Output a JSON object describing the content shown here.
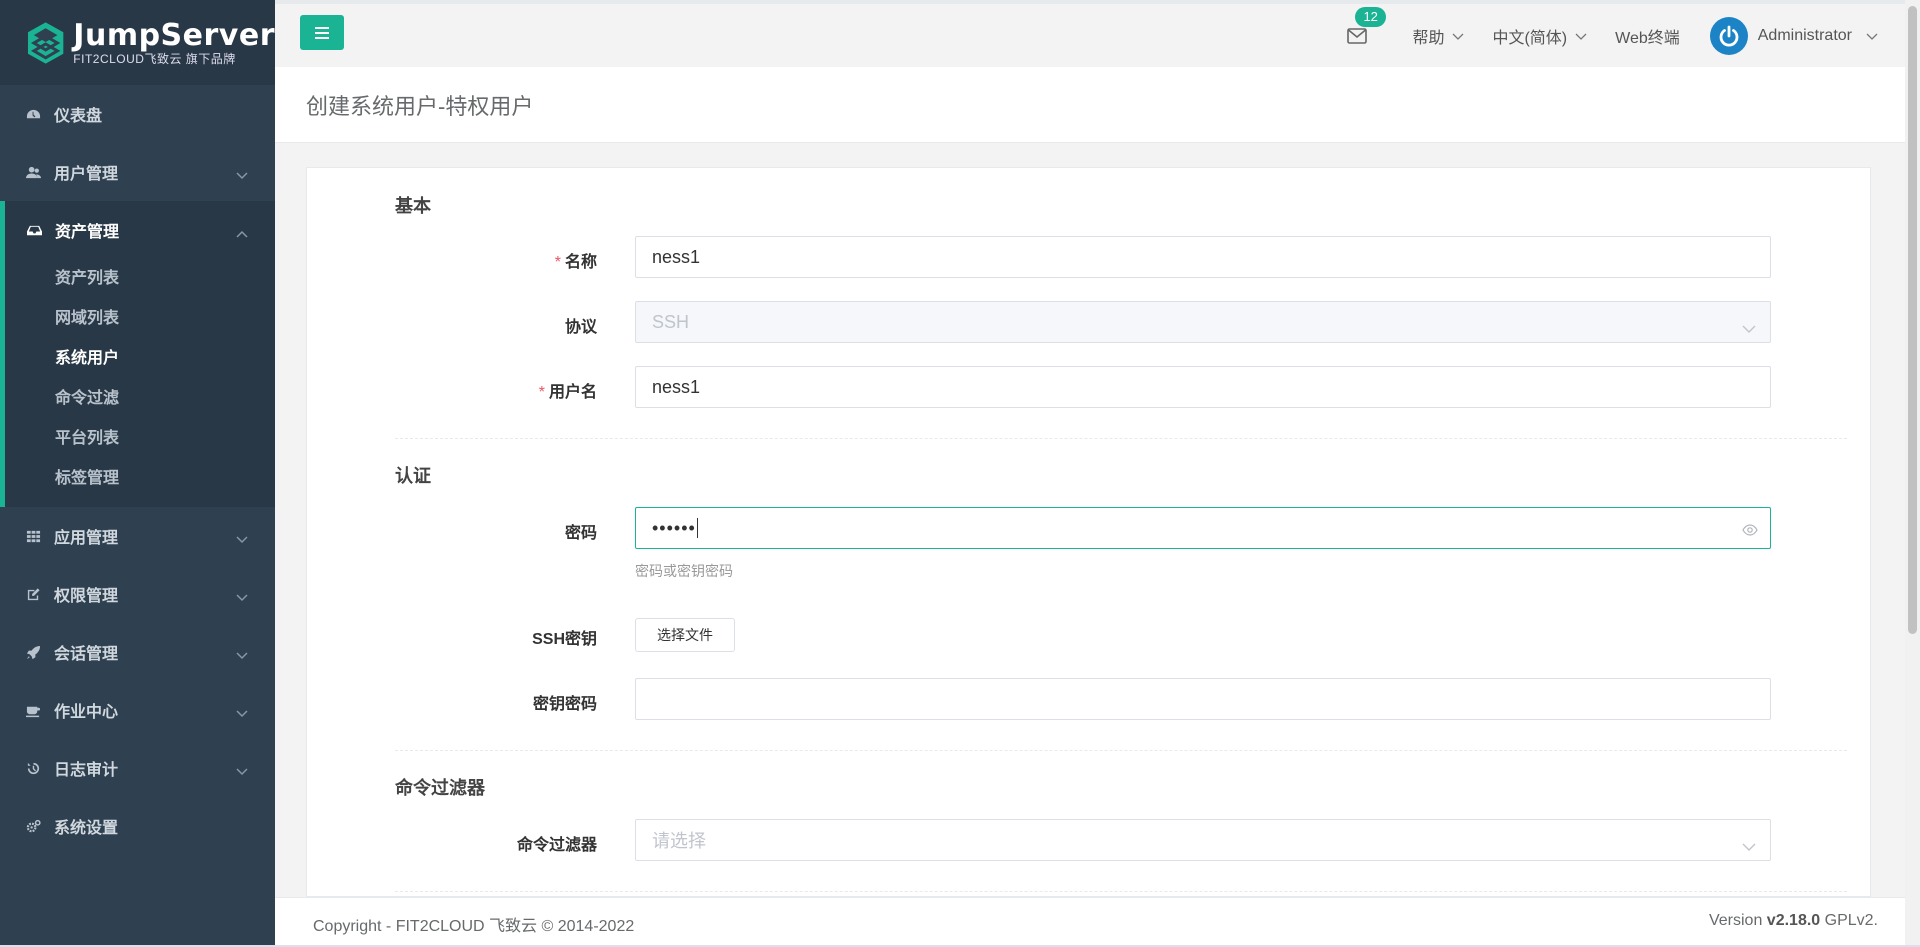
{
  "brand": {
    "title": "JumpServer",
    "subtitle": "FIT2CLOUD飞致云 旗下品牌"
  },
  "sidebar": {
    "items": [
      {
        "label": "仪表盘",
        "icon": "dashboard-icon"
      },
      {
        "label": "用户管理",
        "icon": "users-icon"
      },
      {
        "label": "资产管理",
        "icon": "inbox-icon"
      },
      {
        "label": "应用管理",
        "icon": "grid-icon"
      },
      {
        "label": "权限管理",
        "icon": "edit-icon"
      },
      {
        "label": "会话管理",
        "icon": "rocket-icon"
      },
      {
        "label": "作业中心",
        "icon": "coffee-icon"
      },
      {
        "label": "日志审计",
        "icon": "history-icon"
      },
      {
        "label": "系统设置",
        "icon": "cogs-icon"
      }
    ],
    "asset_sub": [
      "资产列表",
      "网域列表",
      "系统用户",
      "命令过滤",
      "平台列表",
      "标签管理"
    ],
    "active_sub": "系统用户"
  },
  "topbar": {
    "mail_count": "12",
    "help": "帮助",
    "language": "中文(简体)",
    "web_terminal": "Web终端",
    "user": "Administrator"
  },
  "page": {
    "title": "创建系统用户-特权用户"
  },
  "form": {
    "basic": {
      "title": "基本",
      "name_label": "名称",
      "name_value": "ness1",
      "protocol_label": "协议",
      "protocol_value": "SSH",
      "username_label": "用户名",
      "username_value": "ness1"
    },
    "auth": {
      "title": "认证",
      "password_label": "密码",
      "password_value": "••••••",
      "password_help": "密码或密钥密码",
      "ssh_key_label": "SSH密钥",
      "file_button": "选择文件",
      "key_password_label": "密钥密码",
      "key_password_value": ""
    },
    "cmd_filter": {
      "title": "命令过滤器",
      "label": "命令过滤器",
      "placeholder": "请选择"
    }
  },
  "footer": {
    "copyright": "Copyright - FIT2CLOUD 飞致云 © 2014-2022",
    "version_prefix": "Version ",
    "version": "v2.18.0",
    "license": " GPLv2."
  },
  "colors": {
    "accent": "#1ab394",
    "sidebar": "#2f4050",
    "required": "#ed5565"
  }
}
